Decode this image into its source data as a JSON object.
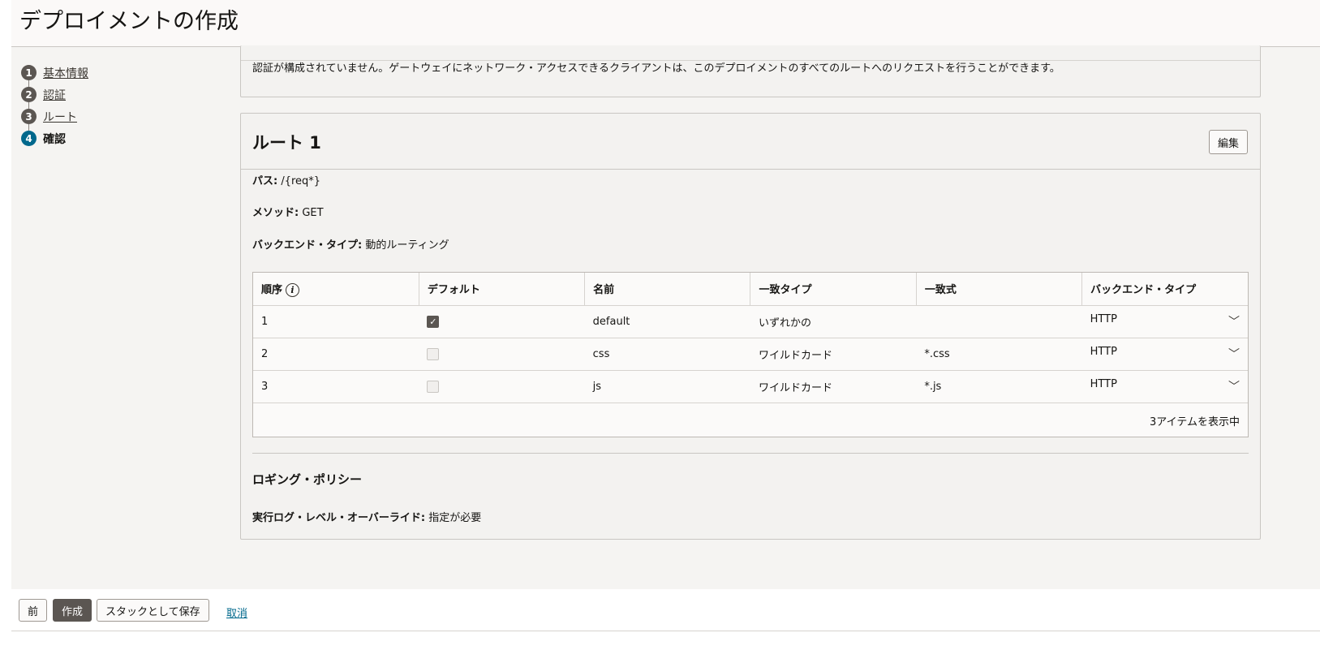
{
  "page": {
    "title": "デプロイメントの作成"
  },
  "steps": [
    {
      "num": "1",
      "label": "基本情報"
    },
    {
      "num": "2",
      "label": "認証"
    },
    {
      "num": "3",
      "label": "ルート"
    },
    {
      "num": "4",
      "label": "確認"
    }
  ],
  "auth": {
    "message": "認証が構成されていません。ゲートウェイにネットワーク・アクセスできるクライアントは、このデプロイメントのすべてのルートへのリクエストを行うことができます。"
  },
  "route": {
    "title": "ルート 1",
    "edit_label": "編集",
    "path_label": "パス:",
    "path_value": "/{req*}",
    "method_label": "メソッド:",
    "method_value": "GET",
    "backend_label": "バックエンド・タイプ:",
    "backend_value": "動的ルーティング",
    "table": {
      "headers": [
        "順序",
        "デフォルト",
        "名前",
        "一致タイプ",
        "一致式",
        "バックエンド・タイプ"
      ],
      "rows": [
        {
          "order": "1",
          "default": true,
          "name": "default",
          "match_type": "いずれかの",
          "expr": "",
          "backend": "HTTP"
        },
        {
          "order": "2",
          "default": false,
          "name": "css",
          "match_type": "ワイルドカード",
          "expr": "*.css",
          "backend": "HTTP"
        },
        {
          "order": "3",
          "default": false,
          "name": "js",
          "match_type": "ワイルドカード",
          "expr": "*.js",
          "backend": "HTTP"
        }
      ],
      "footer": "3アイテムを表示中"
    },
    "logging_title": "ロギング・ポリシー",
    "log_level_label": "実行ログ・レベル・オーバーライド:",
    "log_level_value": "指定が必要"
  },
  "footer": {
    "prev_label": "前",
    "create_label": "作成",
    "save_stack_label": "スタックとして保存",
    "cancel_label": "取消"
  }
}
